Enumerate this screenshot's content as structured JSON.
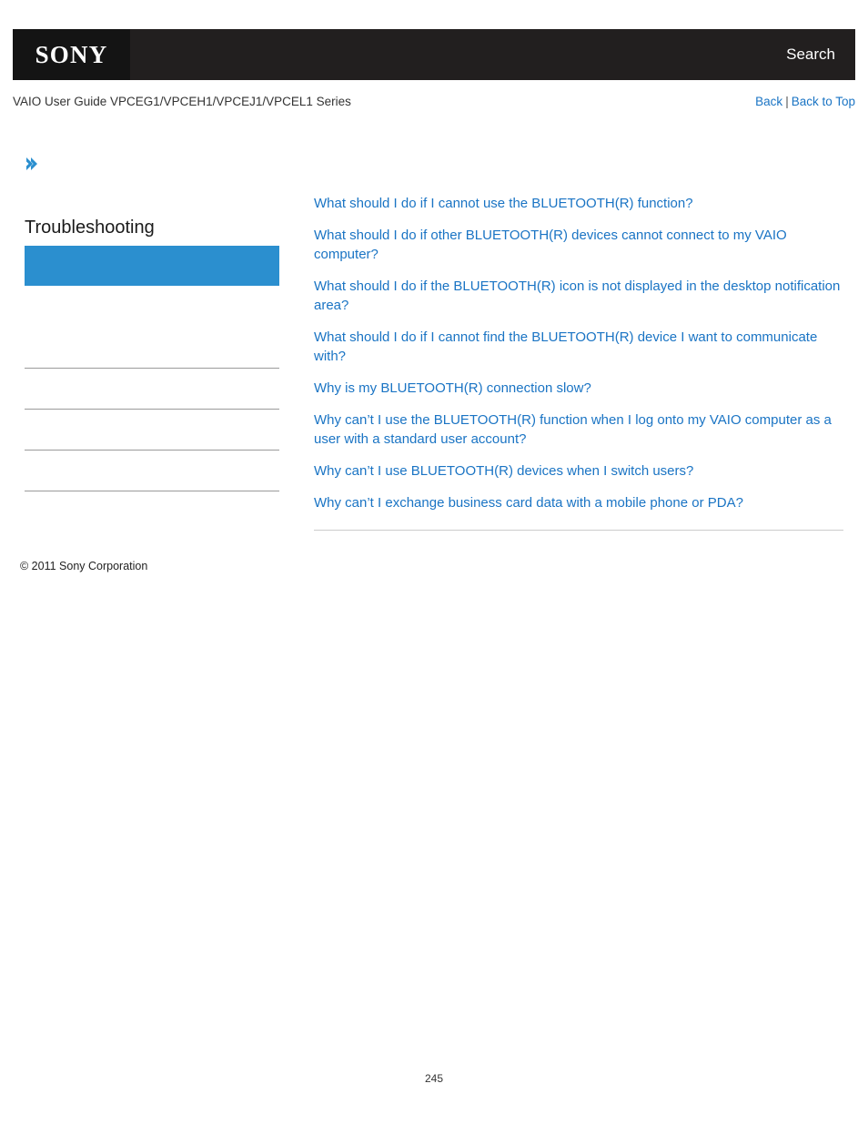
{
  "header": {
    "logo_text": "SONY",
    "search_label": "Search"
  },
  "breadcrumb": {
    "guide_title": "VAIO User Guide VPCEG1/VPCEH1/VPCEJ1/VPCEL1 Series",
    "back_label": "Back",
    "separator": "|",
    "back_to_top_label": "Back to Top"
  },
  "sidebar": {
    "chevron_icon": "double-chevron-right-icon",
    "section_title": "Troubleshooting",
    "items": [
      {
        "label": "",
        "state": "active"
      },
      {
        "label": "",
        "state": "blank"
      },
      {
        "label": "",
        "state": "blank"
      },
      {
        "label": "",
        "state": "blank"
      },
      {
        "label": "",
        "state": "blank"
      },
      {
        "label": "",
        "state": "blank"
      }
    ]
  },
  "main": {
    "links": [
      "What should I do if I cannot use the BLUETOOTH(R) function?",
      "What should I do if other BLUETOOTH(R) devices cannot connect to my VAIO computer?",
      "What should I do if the BLUETOOTH(R) icon is not displayed in the desktop notification area?",
      "What should I do if I cannot find the BLUETOOTH(R) device I want to communicate with?",
      "Why is my BLUETOOTH(R) connection slow?",
      "Why can’t I use the BLUETOOTH(R) function when I log onto my VAIO computer as a user with a standard user account?",
      "Why can’t I use BLUETOOTH(R) devices when I switch users?",
      "Why can’t I exchange business card data with a mobile phone or PDA?"
    ]
  },
  "footer": {
    "copyright": "© 2011 Sony Corporation",
    "page_number": "245"
  },
  "colors": {
    "header_background": "#221f1f",
    "logo_background": "#141414",
    "link_blue": "#1a74c4",
    "active_nav_blue": "#2b8fcf",
    "rule_gray": "#9a9a9a"
  }
}
